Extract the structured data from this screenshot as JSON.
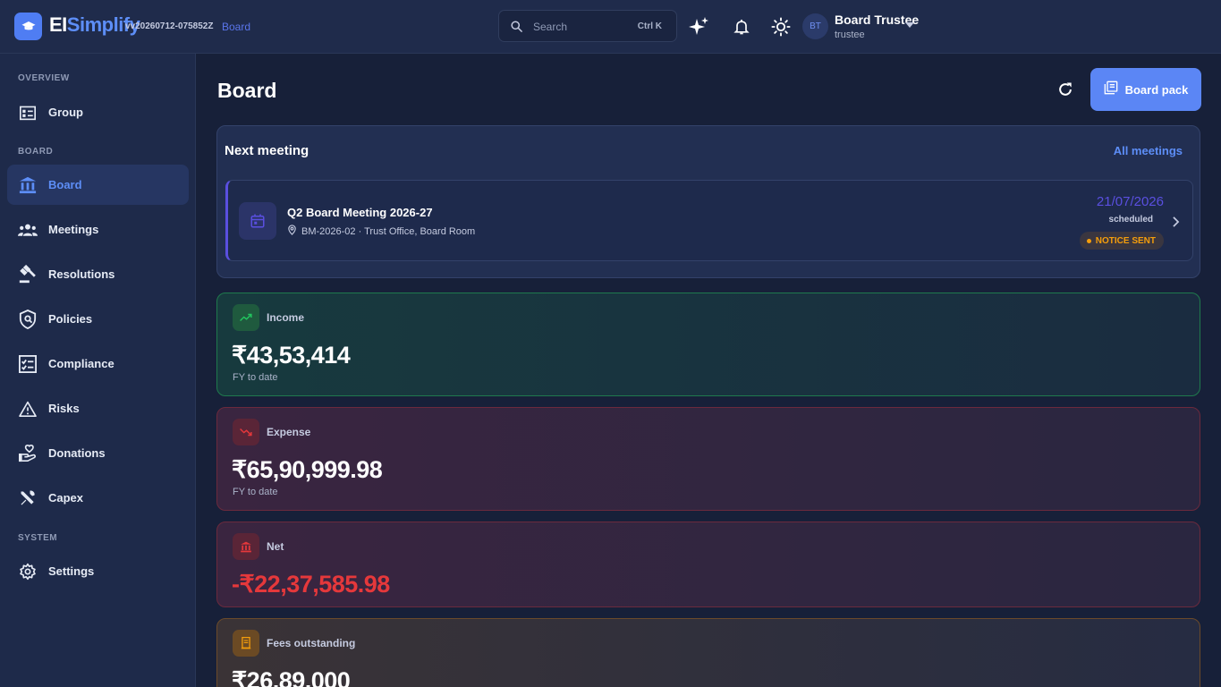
{
  "app": {
    "brand_part1": "EI",
    "brand_part2": "Simplify",
    "version": "vv20260712-075852Z",
    "breadcrumb": "Board"
  },
  "search": {
    "placeholder": "Search",
    "shortcut": "Ctrl K"
  },
  "user": {
    "initials": "BT",
    "name": "Board Trustee",
    "role": "trustee"
  },
  "sidebar": {
    "sections": [
      {
        "label": "OVERVIEW",
        "items": [
          {
            "label": "Group",
            "icon": "group-icon"
          }
        ]
      },
      {
        "label": "BOARD",
        "items": [
          {
            "label": "Board",
            "icon": "bank-icon",
            "active": true
          },
          {
            "label": "Meetings",
            "icon": "people-icon"
          },
          {
            "label": "Resolutions",
            "icon": "gavel-icon"
          },
          {
            "label": "Policies",
            "icon": "shield-icon"
          },
          {
            "label": "Compliance",
            "icon": "checklist-icon"
          },
          {
            "label": "Risks",
            "icon": "warning-icon"
          },
          {
            "label": "Donations",
            "icon": "donation-icon"
          },
          {
            "label": "Capex",
            "icon": "tools-icon"
          }
        ]
      },
      {
        "label": "SYSTEM",
        "items": [
          {
            "label": "Settings",
            "icon": "gear-icon"
          }
        ]
      }
    ]
  },
  "main": {
    "title": "Board",
    "board_pack_label": "Board pack",
    "next_meeting": {
      "heading": "Next meeting",
      "all_link": "All meetings",
      "title": "Q2 Board Meeting 2026-27",
      "subtitle": "BM-2026-02 · Trust Office, Board Room",
      "date": "21/07/2026",
      "status": "scheduled",
      "badge": "NOTICE SENT"
    },
    "stats": [
      {
        "label": "Income",
        "value": "₹43,53,414",
        "sub": "FY to date",
        "icon": "trend-up-icon"
      },
      {
        "label": "Expense",
        "value": "₹65,90,999.98",
        "sub": "FY to date",
        "icon": "trend-down-icon"
      },
      {
        "label": "Net",
        "value": "-₹22,37,585.98",
        "icon": "bank-icon"
      },
      {
        "label": "Fees outstanding",
        "value": "₹26,89,000",
        "icon": "receipt-icon"
      }
    ]
  },
  "colors": {
    "accent": "#5b86f5",
    "income_border": "#1f7a4d",
    "expense_border": "#6b2a3d",
    "net_negative": "#e5383b",
    "badge_amber": "#f59e0b"
  }
}
